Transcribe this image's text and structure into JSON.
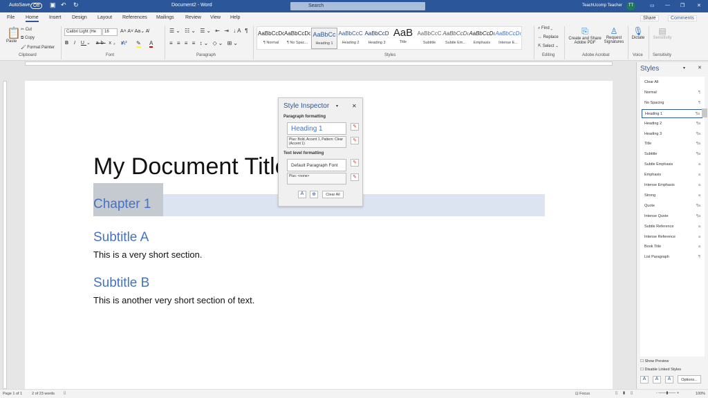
{
  "titlebar": {
    "autosave": "AutoSave",
    "autosave_state": "Off",
    "title": "Document2 - Word",
    "search": "Search",
    "user": "TeachUcomp Teacher",
    "avatar": "TT"
  },
  "tabs": [
    "File",
    "Home",
    "Insert",
    "Design",
    "Layout",
    "References",
    "Mailings",
    "Review",
    "View",
    "Help"
  ],
  "actions": {
    "share": "Share",
    "comments": "Comments"
  },
  "ribbon": {
    "clipboard": {
      "paste": "Paste",
      "cut": "Cut",
      "copy": "Copy",
      "format_painter": "Format Painter",
      "label": "Clipboard"
    },
    "font": {
      "name": "Calibri Light (He",
      "size": "16",
      "label": "Font"
    },
    "paragraph": {
      "label": "Paragraph"
    },
    "styles": {
      "label": "Styles",
      "items": [
        {
          "preview": "AaBbCcDc",
          "name": "¶ Normal"
        },
        {
          "preview": "AaBbCcDc",
          "name": "¶ No Spac..."
        },
        {
          "preview": "AaBbCc",
          "name": "Heading 1"
        },
        {
          "preview": "AaBbCcC",
          "name": "Heading 2"
        },
        {
          "preview": "AaBbCcD",
          "name": "Heading 3"
        },
        {
          "preview": "AaB",
          "name": "Title"
        },
        {
          "preview": "AaBbCcC",
          "name": "Subtitle"
        },
        {
          "preview": "AaBbCcDı",
          "name": "Subtle Em..."
        },
        {
          "preview": "AaBbCcDı",
          "name": "Emphasis"
        },
        {
          "preview": "AaBbCcDı",
          "name": "Intense E..."
        }
      ]
    },
    "editing": {
      "find": "Find",
      "replace": "Replace",
      "select": "Select",
      "label": "Editing"
    },
    "acrobat": {
      "create": "Create and Share",
      "create2": "Adobe PDF",
      "request": "Request",
      "request2": "Signatures",
      "label": "Adobe Acrobat"
    },
    "voice": {
      "dictate": "Dictate",
      "label": "Voice"
    },
    "sensitivity": {
      "button": "Sensitivity",
      "label": "Sensitivity"
    }
  },
  "document": {
    "title": "My Document Title",
    "chapter": "Chapter 1",
    "subtitle_a": "Subtitle A",
    "text_a": "This is a very short section.",
    "subtitle_b": "Subtitle B",
    "text_b": "This is another very short section of text."
  },
  "inspector": {
    "title": "Style Inspector",
    "para_label": "Paragraph formatting",
    "para_style": "Heading 1",
    "para_plus": "Plus: Bold, Accent 1, Pattern: Clear (Accent 1)",
    "text_label": "Text level formatting",
    "text_style": "Default Paragraph Font",
    "text_plus": "Plus: <none>",
    "clear_all": "Clear All"
  },
  "styles_pane": {
    "title": "Styles",
    "selected": "Heading 1",
    "items": [
      {
        "name": "Clear All",
        "mark": ""
      },
      {
        "name": "Normal",
        "mark": "¶"
      },
      {
        "name": "No Spacing",
        "mark": "¶"
      },
      {
        "name": "Heading 1",
        "mark": "¶a"
      },
      {
        "name": "Heading 2",
        "mark": "¶a"
      },
      {
        "name": "Heading 3",
        "mark": "¶a"
      },
      {
        "name": "Title",
        "mark": "¶a"
      },
      {
        "name": "Subtitle",
        "mark": "¶a"
      },
      {
        "name": "Subtle Emphasis",
        "mark": "a"
      },
      {
        "name": "Emphasis",
        "mark": "a"
      },
      {
        "name": "Intense Emphasis",
        "mark": "a"
      },
      {
        "name": "Strong",
        "mark": "a"
      },
      {
        "name": "Quote",
        "mark": "¶a"
      },
      {
        "name": "Intense Quote",
        "mark": "¶a"
      },
      {
        "name": "Subtle Reference",
        "mark": "a"
      },
      {
        "name": "Intense Reference",
        "mark": "a"
      },
      {
        "name": "Book Title",
        "mark": "a"
      },
      {
        "name": "List Paragraph",
        "mark": "¶"
      }
    ],
    "show_preview": "Show Preview",
    "disable_linked": "Disable Linked Styles",
    "options": "Options..."
  },
  "status": {
    "page": "Page 1 of 1",
    "words": "2 of 23 words",
    "focus": "Focus",
    "zoom": "100%"
  },
  "colors": {
    "brand": "#2b579a",
    "heading": "#4472c4"
  }
}
